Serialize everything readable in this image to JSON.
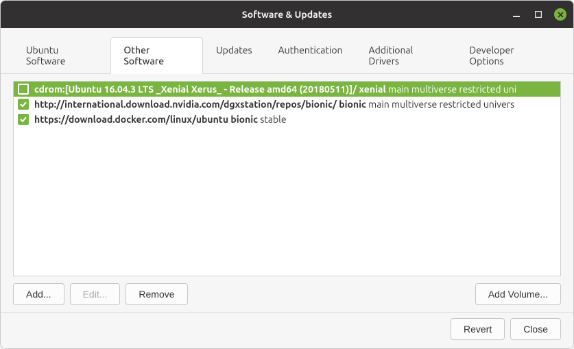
{
  "window": {
    "title": "Software & Updates"
  },
  "tabs": [
    {
      "label": "Ubuntu Software"
    },
    {
      "label": "Other Software"
    },
    {
      "label": "Updates"
    },
    {
      "label": "Authentication"
    },
    {
      "label": "Additional Drivers"
    },
    {
      "label": "Developer Options"
    }
  ],
  "active_tab": 1,
  "sources": [
    {
      "checked": false,
      "selected": true,
      "repo": "cdrom:[Ubuntu 16.04.3 LTS _Xenial Xerus_ - Release amd64 (20180511)]/ xenial",
      "components": "main multiverse restricted uni"
    },
    {
      "checked": true,
      "selected": false,
      "repo": "http://international.download.nvidia.com/dgxstation/repos/bionic/ bionic",
      "components": "main multiverse restricted univers"
    },
    {
      "checked": true,
      "selected": false,
      "repo": "https://download.docker.com/linux/ubuntu bionic",
      "components": "stable"
    }
  ],
  "buttons": {
    "add": "Add...",
    "edit": "Edit...",
    "remove": "Remove",
    "add_volume": "Add Volume...",
    "revert": "Revert",
    "close": "Close"
  }
}
